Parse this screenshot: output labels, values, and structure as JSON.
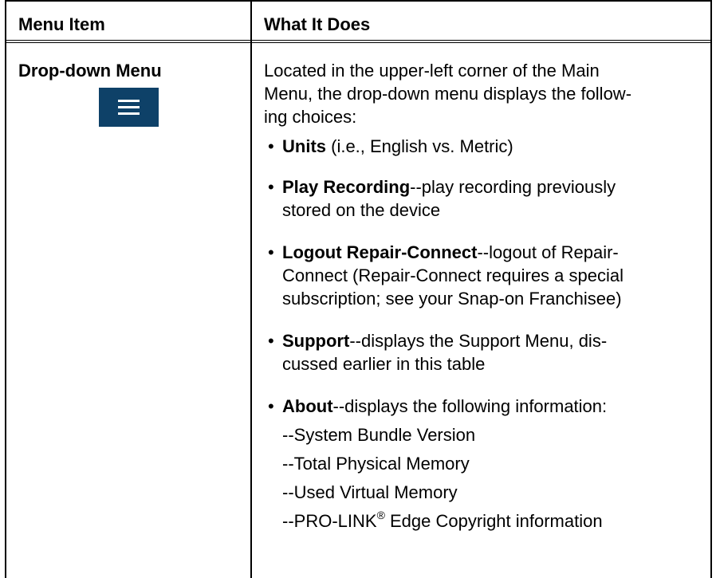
{
  "table": {
    "headers": [
      "Menu Item",
      "What It Does"
    ],
    "row": {
      "item": "Drop-down Menu",
      "icon": "hamburger-menu-icon",
      "icon_color": "#0e4168",
      "description_lines": [
        "Located in the upper-left corner of the Main",
        "Menu, the drop-down menu displays the follow-",
        "ing choices:"
      ],
      "bullets": [
        {
          "term": "Units",
          "text": " (i.e., English vs. Metric)",
          "cont": ""
        },
        {
          "term": "Play Recording",
          "text": "--play recording previously",
          "cont": "stored on the device"
        },
        {
          "term": "Logout Repair-Connect",
          "text": "--logout of Repair-",
          "cont": "Connect (Repair-Connect requires a special",
          "cont2": "subscription; see your Snap-on Franchisee)"
        },
        {
          "term": "Support",
          "text": "--displays the Support Menu, dis-",
          "cont": "cussed earlier in this table"
        },
        {
          "term": "About",
          "text": "--displays the following information:",
          "cont": ""
        }
      ],
      "about_items": [
        "--System Bundle Version",
        "--Total Physical Memory",
        "--Used Virtual Memory"
      ],
      "about_last": {
        "prefix": "--PRO-LINK",
        "reg": "®",
        "suffix": " Edge Copyright information"
      }
    }
  }
}
